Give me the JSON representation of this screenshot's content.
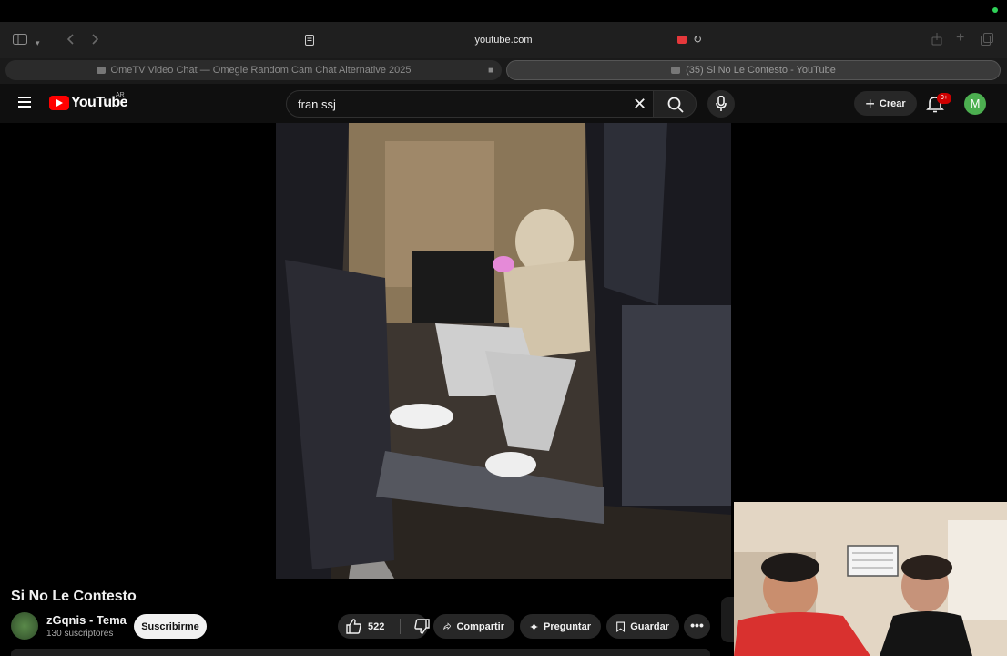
{
  "browser": {
    "url": "youtube.com",
    "tabs": [
      {
        "title": "OmeTV Video Chat — Omegle Random Cam Chat Alternative 2025"
      },
      {
        "title": "(35) Si No Le Contesto - YouTube"
      }
    ]
  },
  "header": {
    "logo_text": "YouTube",
    "country_code": "AR",
    "search_value": "fran ssj",
    "create_label": "Crear",
    "notifications_badge": "9+",
    "avatar_letter": "M"
  },
  "video": {
    "title": "Si No Le Contesto",
    "channel_name": "zGqnis - Tema",
    "subscribers": "130 suscriptores",
    "subscribe_label": "Suscribirme",
    "likes": "522",
    "share_label": "Compartir",
    "ask_label": "Preguntar",
    "save_label": "Guardar"
  },
  "colors": {
    "brand_red": "#ff0000",
    "badge_red": "#cc0000",
    "avatar_green": "#4caf50",
    "recording_red": "#e5383b"
  },
  "icons": [
    "sidebar-icon",
    "back-icon",
    "forward-icon",
    "reader-icon",
    "camera-icon",
    "reload-icon",
    "share-icon",
    "new-tab-icon",
    "tabs-icon",
    "menu-icon",
    "clear-icon",
    "search-icon",
    "microphone-icon",
    "plus-icon",
    "bell-icon",
    "like-icon",
    "dislike-icon",
    "share-arrow-icon",
    "sparkle-icon",
    "bookmark-icon",
    "more-icon"
  ]
}
